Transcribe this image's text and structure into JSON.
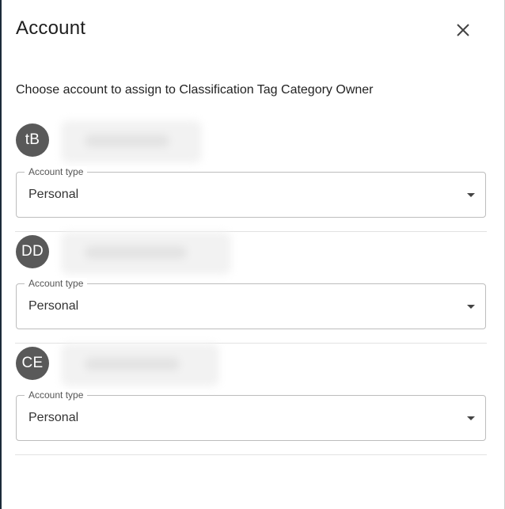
{
  "dialog": {
    "title": "Account",
    "close_icon": "close-icon",
    "subtitle": "Choose account to assign to Classification Tag Category Owner"
  },
  "accounts": [
    {
      "initials": "tB",
      "avatar_color": "#595959",
      "account_type_label": "Account type",
      "account_type_value": "Personal"
    },
    {
      "initials": "DD",
      "avatar_color": "#595959",
      "account_type_label": "Account type",
      "account_type_value": "Personal"
    },
    {
      "initials": "CE",
      "avatar_color": "#595959",
      "account_type_label": "Account type",
      "account_type_value": "Personal"
    }
  ]
}
